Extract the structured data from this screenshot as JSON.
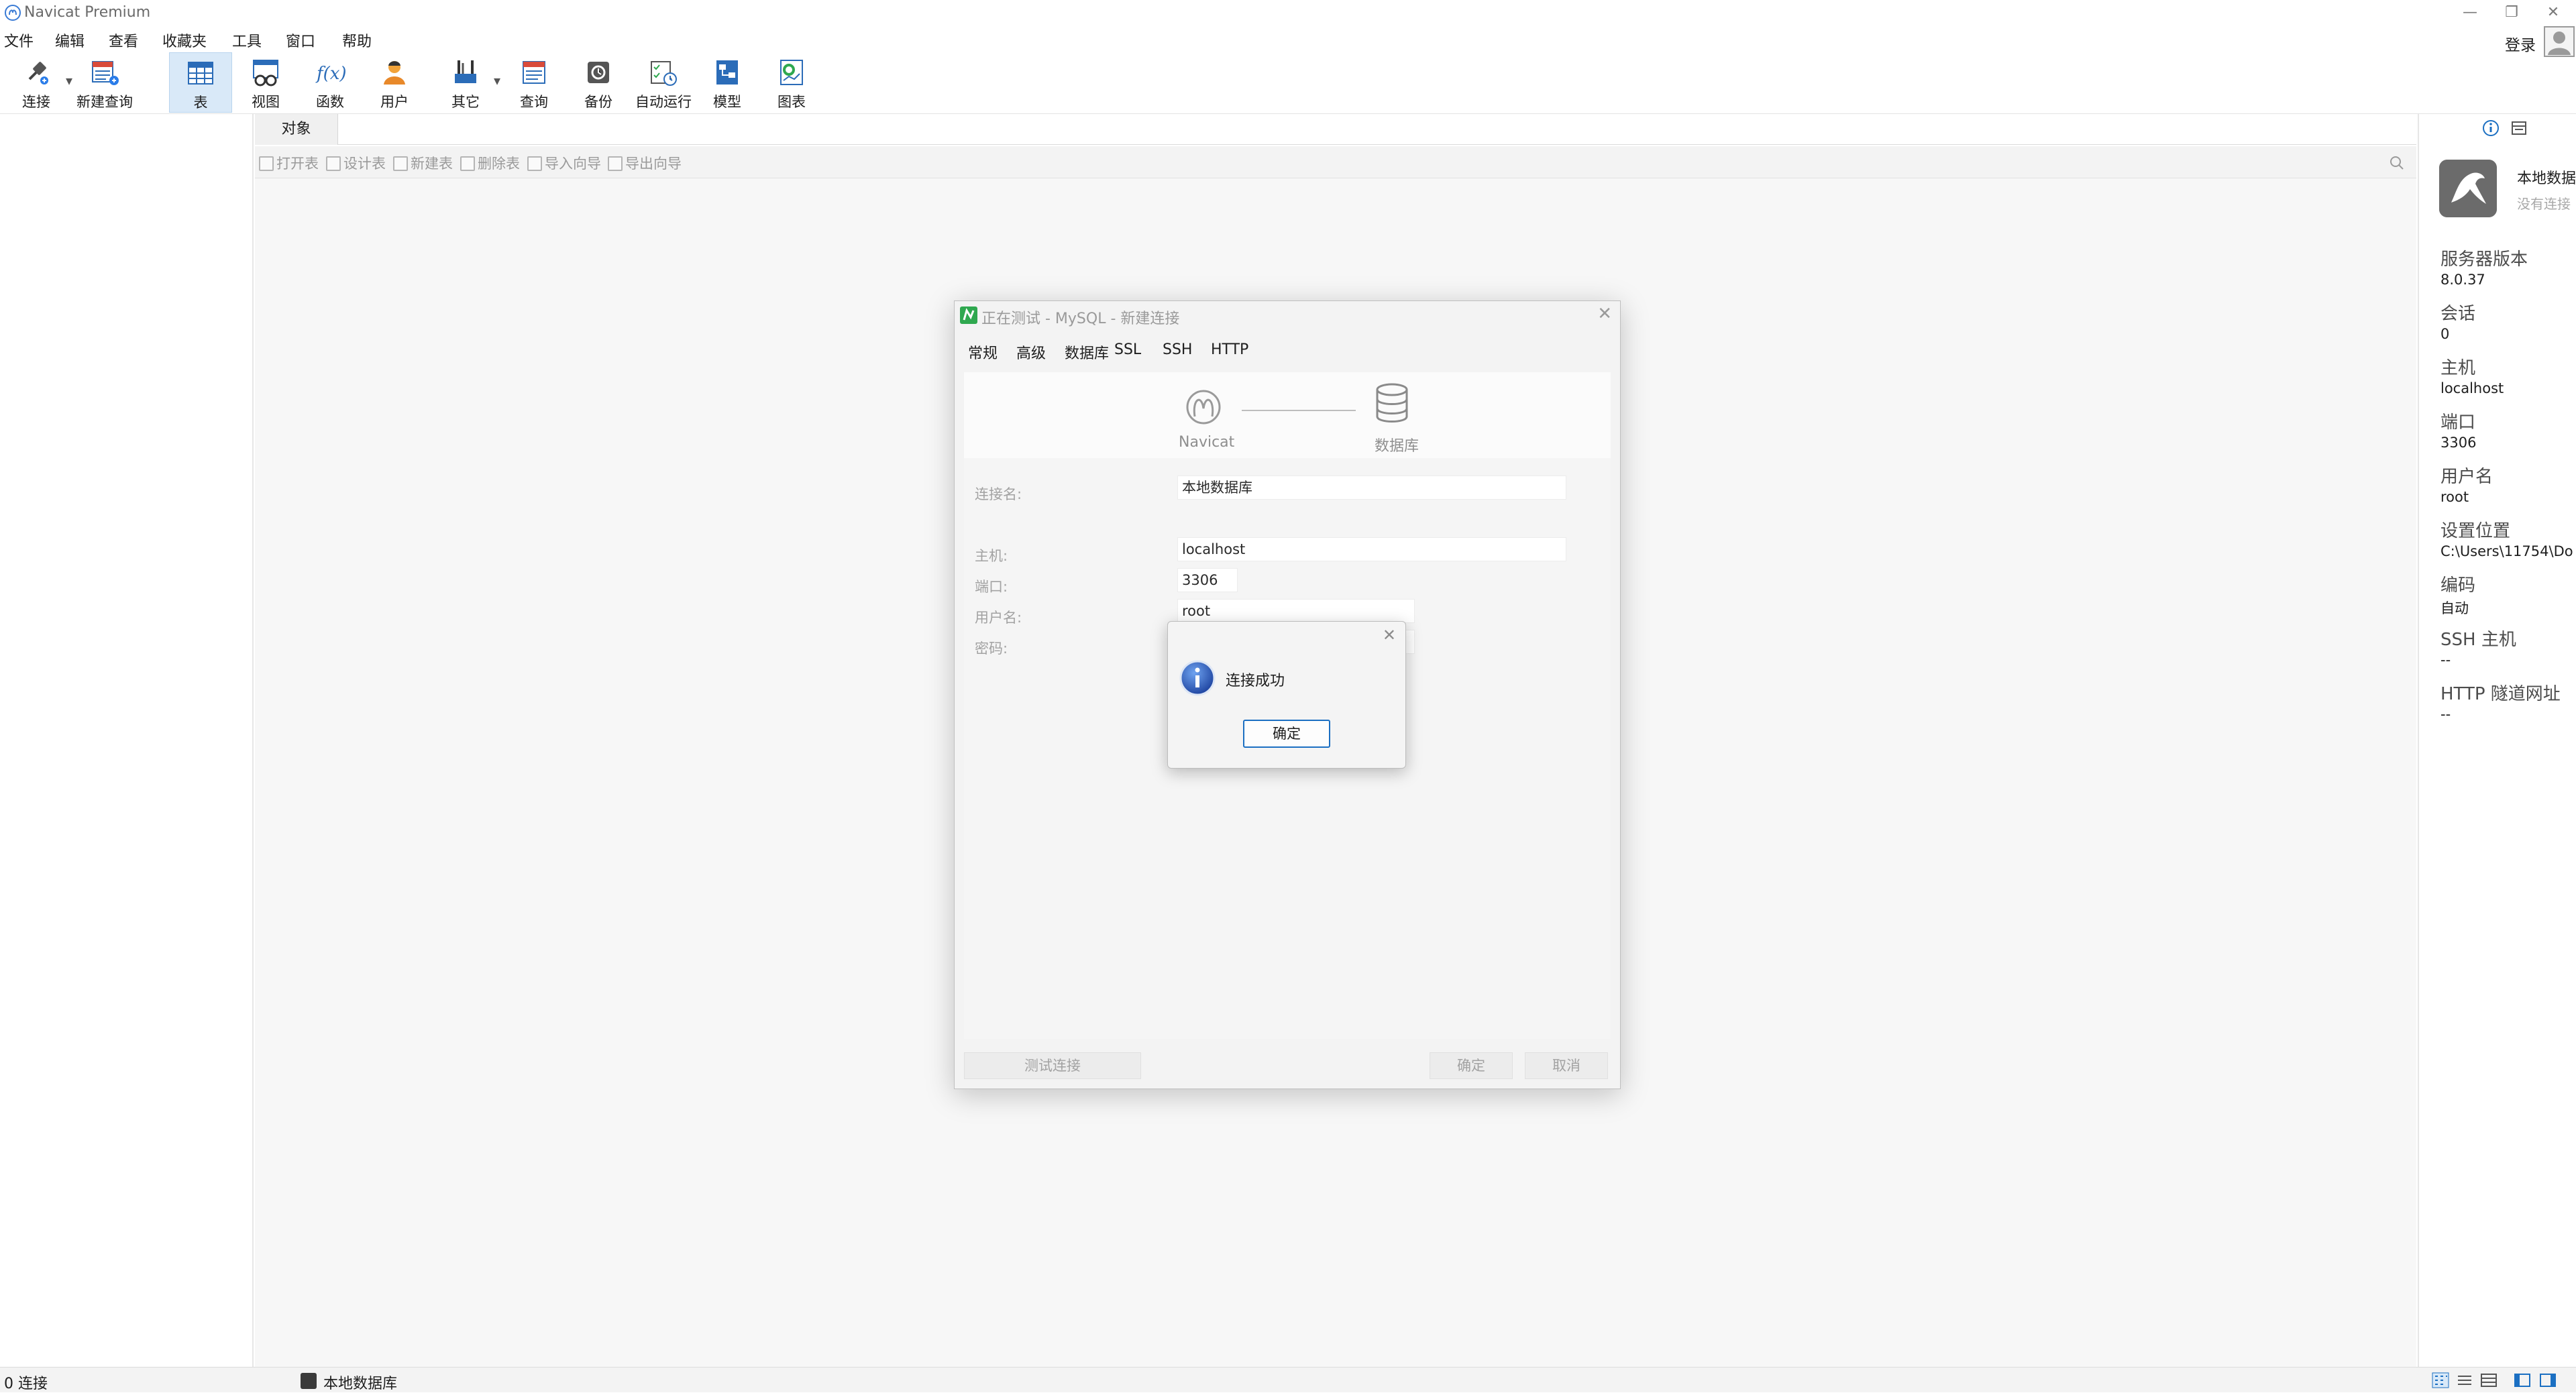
{
  "window": {
    "title": "Navicat Premium"
  },
  "menu": [
    "文件",
    "编辑",
    "查看",
    "收藏夹",
    "工具",
    "窗口",
    "帮助"
  ],
  "header": {
    "login": "登录"
  },
  "toolbar": {
    "connect": "连接",
    "new_query": "新建查询",
    "table": "表",
    "view": "视图",
    "function": "函数",
    "user": "用户",
    "other": "其它",
    "query": "查询",
    "backup": "备份",
    "automation": "自动运行",
    "model": "模型",
    "chart": "图表"
  },
  "objects": {
    "tab": "对象",
    "actions": [
      "打开表",
      "设计表",
      "新建表",
      "删除表",
      "导入向导",
      "导出向导"
    ]
  },
  "info": {
    "conn_name": "本地数据库",
    "conn_status": "没有连接",
    "items": [
      {
        "label": "服务器版本",
        "value": "8.0.37"
      },
      {
        "label": "会话",
        "value": "0"
      },
      {
        "label": "主机",
        "value": "localhost"
      },
      {
        "label": "端口",
        "value": "3306"
      },
      {
        "label": "用户名",
        "value": "root"
      },
      {
        "label": "设置位置",
        "value": "C:\\Users\\11754\\Do"
      },
      {
        "label": "编码",
        "value": "自动"
      },
      {
        "label": "SSH 主机",
        "value": "--"
      },
      {
        "label": "HTTP 隧道网址",
        "value": "--"
      }
    ]
  },
  "status": {
    "connections": "0 连接",
    "current": "本地数据库"
  },
  "dialog": {
    "title": "正在测试 - MySQL - 新建连接",
    "tabs": [
      "常规",
      "高级",
      "数据库",
      "SSL",
      "SSH",
      "HTTP"
    ],
    "graphic": {
      "left": "Navicat",
      "right": "数据库"
    },
    "fields": {
      "conn_name_label": "连接名:",
      "conn_name_value": "本地数据库",
      "host_label": "主机:",
      "host_value": "localhost",
      "port_label": "端口:",
      "port_value": "3306",
      "user_label": "用户名:",
      "user_value": "root",
      "password_label": "密码:"
    },
    "buttons": {
      "test": "测试连接",
      "ok": "确定",
      "cancel": "取消"
    }
  },
  "messagebox": {
    "text": "连接成功",
    "ok": "确定"
  },
  "colors": {
    "accent": "#1b6fc2",
    "active_tool_bg": "#d9e9f8",
    "navicat_green": "#2fa84f"
  }
}
